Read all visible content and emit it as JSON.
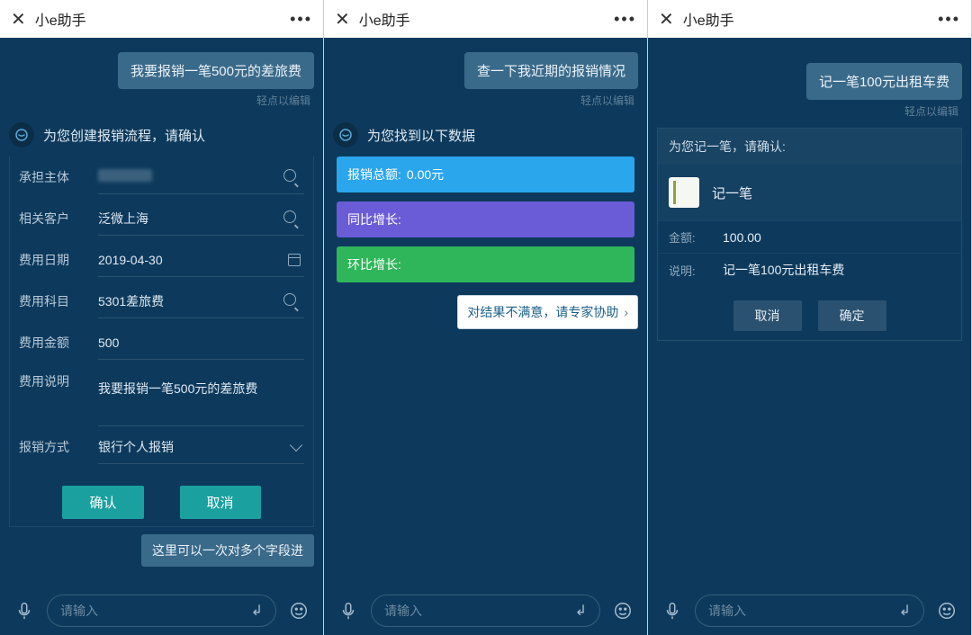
{
  "app_title": "小e助手",
  "edit_hint": "轻点以编辑",
  "input_placeholder": "请输入",
  "panel1": {
    "user_msg": "我要报销一笔500元的差旅费",
    "bot_msg": "为您创建报销流程，请确认",
    "form": {
      "subject": {
        "label": "承担主体",
        "value": ""
      },
      "customer": {
        "label": "相关客户",
        "value": "泛微上海"
      },
      "date": {
        "label": "费用日期",
        "value": "2019-04-30"
      },
      "category": {
        "label": "费用科目",
        "value": "5301差旅费"
      },
      "amount": {
        "label": "费用金额",
        "value": "500"
      },
      "desc": {
        "label": "费用说明",
        "value": "我要报销一笔500元的差旅费"
      },
      "method": {
        "label": "报销方式",
        "value": "银行个人报销"
      }
    },
    "confirm": "确认",
    "cancel": "取消",
    "bottom_hint": "这里可以一次对多个字段进"
  },
  "panel2": {
    "user_msg": "查一下我近期的报销情况",
    "bot_msg": "为您找到以下数据",
    "stats": {
      "total": {
        "label": "报销总额:",
        "value": "0.00元"
      },
      "yoy": {
        "label": "同比增长:",
        "value": ""
      },
      "mom": {
        "label": "环比增长:",
        "value": ""
      }
    },
    "expert_help": "对结果不满意，请专家协助"
  },
  "panel3": {
    "user_msg": "记一笔100元出租车费",
    "card_head": "为您记一笔，请确认:",
    "card_title": "记一笔",
    "fields": {
      "amount": {
        "label": "金额:",
        "value": "100.00"
      },
      "desc": {
        "label": "说明:",
        "value": "记一笔100元出租车费"
      }
    },
    "cancel": "取消",
    "confirm": "确定"
  }
}
